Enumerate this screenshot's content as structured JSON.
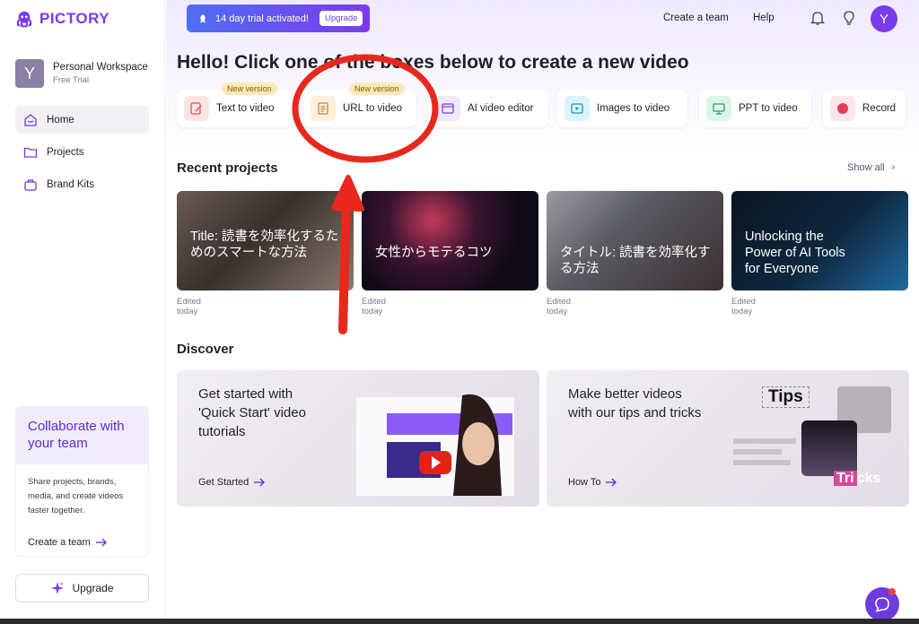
{
  "brand": {
    "name": "PICTORY",
    "color": "#7c3aed"
  },
  "workspace": {
    "initial": "Y",
    "name": "Personal Workspace",
    "plan": "Free Trial"
  },
  "nav": [
    {
      "label": "Home",
      "icon": "home-icon",
      "active": true
    },
    {
      "label": "Projects",
      "icon": "folder-icon",
      "active": false
    },
    {
      "label": "Brand Kits",
      "icon": "brand-kit-icon",
      "active": false
    }
  ],
  "collab": {
    "title": "Collaborate with your team",
    "body": "Share projects, brands, media, and create videos faster together.",
    "link": "Create a team"
  },
  "upgrade": {
    "label": "Upgrade",
    "icon": "sparkle-icon"
  },
  "topbar": {
    "trial_text": "14 day trial activated!",
    "trial_button": "Upgrade",
    "create_team": "Create a team",
    "help": "Help",
    "user_initial": "Y"
  },
  "hello": "Hello! Click one of the boxes below to create a new video",
  "tiles": [
    {
      "label": "Text to video",
      "badge": "New version",
      "icon": "text-to-video-icon"
    },
    {
      "label": "URL to video",
      "badge": "New version",
      "icon": "url-to-video-icon"
    },
    {
      "label": "AI video editor",
      "badge": "",
      "icon": "ai-editor-icon"
    },
    {
      "label": "Images to video",
      "badge": "",
      "icon": "images-to-video-icon"
    },
    {
      "label": "PPT to video",
      "badge": "",
      "icon": "ppt-to-video-icon"
    },
    {
      "label": "Record",
      "badge": "",
      "icon": "record-icon"
    }
  ],
  "recent": {
    "title": "Recent projects",
    "show_all": "Show all",
    "items": [
      {
        "title": "Title: 読書を効率化するためのスマートな方法",
        "edited": "Edited today"
      },
      {
        "title": "女性からモテるコツ",
        "edited": "Edited today"
      },
      {
        "title": "タイトル: 読書を効率化する方法",
        "edited": "Edited today"
      },
      {
        "title": "Unlocking the Power of AI Tools for Everyone",
        "edited": "Edited today"
      }
    ]
  },
  "discover": {
    "title": "Discover",
    "cards": [
      {
        "title": "Get started with 'Quick Start' video tutorials",
        "link": "Get Started"
      },
      {
        "title": "Make better videos with our tips and tricks",
        "link": "How To",
        "art_tips": "Tips",
        "art_tricks_a": "Tri",
        "art_tricks_b": "cks"
      }
    ]
  }
}
